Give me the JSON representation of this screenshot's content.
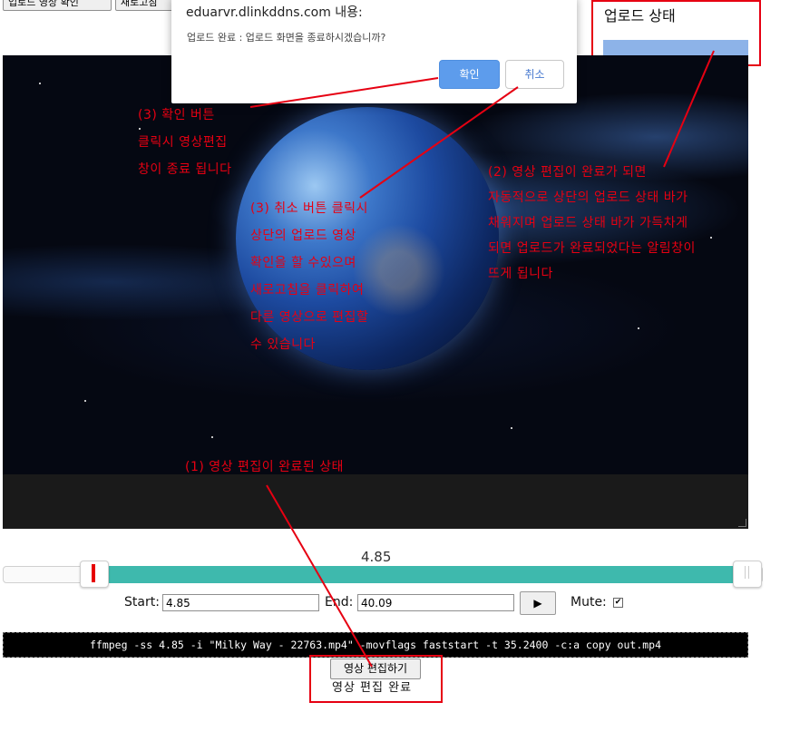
{
  "top_buttons": [
    "업로드 영상 확인",
    "새로고침"
  ],
  "dialog": {
    "origin": "eduarvr.dlinkddns.com 내용:",
    "message": "업로드 완료 : 업로드 화면을 종료하시겠습니까?",
    "ok_label": "확인",
    "cancel_label": "취소"
  },
  "upload_status": {
    "title": "업로드 상태",
    "progress": 1.0
  },
  "annotations": {
    "ann1": "(1) 영상 편집이 완료된 상태",
    "ann2": "(2) 영상 편집이 완료가 되면\n자동적으로 상단의 업로드 상태 바가\n채워지며 업로드 상태 바가 가득차게\n되면 업로드가 완료되었다는 알림창이\n뜨게 됩니다",
    "ann3_ok": "(3) 확인 버튼\n클릭시 영상편집\n창이 종료 됩니다",
    "ann3_cancel": "(3) 취소 버튼 클릭시\n상단의 업로드 영상\n확인을 할 수있으며\n새로고침을 클릭하여\n다른 영상으로 편집할\n수 있습니다"
  },
  "slider": {
    "value": "4.85"
  },
  "controls": {
    "start_label": "Start:",
    "start_value": "4.85",
    "end_label": "End:",
    "end_value": "40.09",
    "play_icon": "▶",
    "mute_label": "Mute:",
    "mute_checked": "✔"
  },
  "command": "ffmpeg -ss 4.85 -i \"Milky Way - 22763.mp4\" -movflags faststart -t 35.2400 -c:a copy out.mp4",
  "edit_button": "영상 편집하기",
  "status_text": "영상 편집 완료",
  "colors": {
    "annotation": "#e60012",
    "range": "#3eb9ad",
    "primary_button": "#5d9cec",
    "upload_bar": "#8db3e8"
  }
}
